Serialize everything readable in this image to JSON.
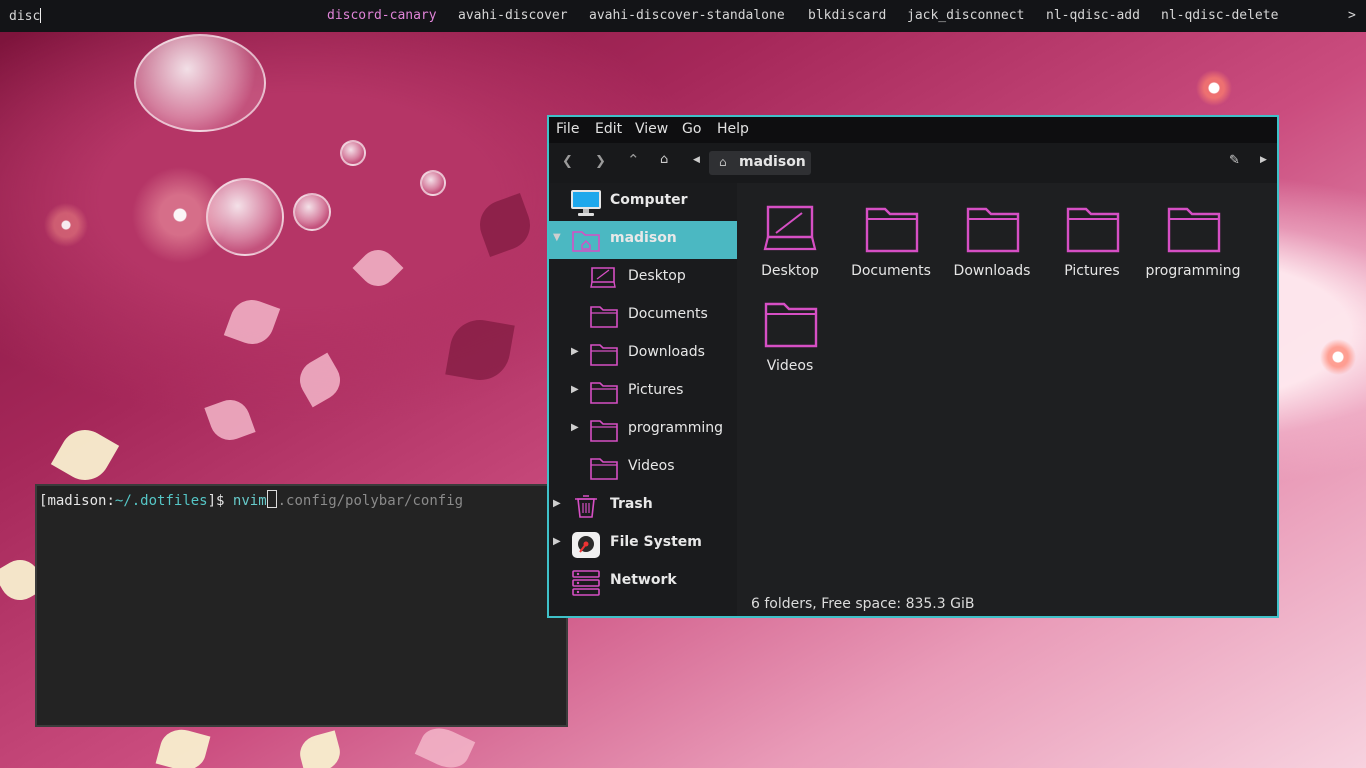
{
  "dmenu": {
    "query": "disc",
    "items": [
      "discord-canary",
      "avahi-discover",
      "avahi-discover-standalone",
      "blkdiscard",
      "jack_disconnect",
      "nl-qdisc-add",
      "nl-qdisc-delete"
    ],
    "selected_index": 0,
    "more": ">"
  },
  "terminal": {
    "prompt_open": "[",
    "user": "madison",
    "colon": ":",
    "cwd": "~/.dotfiles",
    "prompt_close": "]$ ",
    "command": "nvim",
    "suggestion": ".config/polybar/config"
  },
  "file_manager": {
    "menu": [
      "File",
      "Edit",
      "View",
      "Go",
      "Help"
    ],
    "location": "madison",
    "sidebar": {
      "computer": "Computer",
      "home": "madison",
      "home_items": [
        "Desktop",
        "Documents",
        "Downloads",
        "Pictures",
        "programming",
        "Videos"
      ],
      "trash": "Trash",
      "filesystem": "File System",
      "network": "Network"
    },
    "items": [
      "Desktop",
      "Documents",
      "Downloads",
      "Pictures",
      "programming",
      "Videos"
    ],
    "status": "6 folders, Free space: 835.3 GiB"
  },
  "colors": {
    "accent": "#3fc1c9",
    "selection": "#4bb8c2",
    "folder": "#d64fc4",
    "dmenu_selected": "#e084d8"
  }
}
